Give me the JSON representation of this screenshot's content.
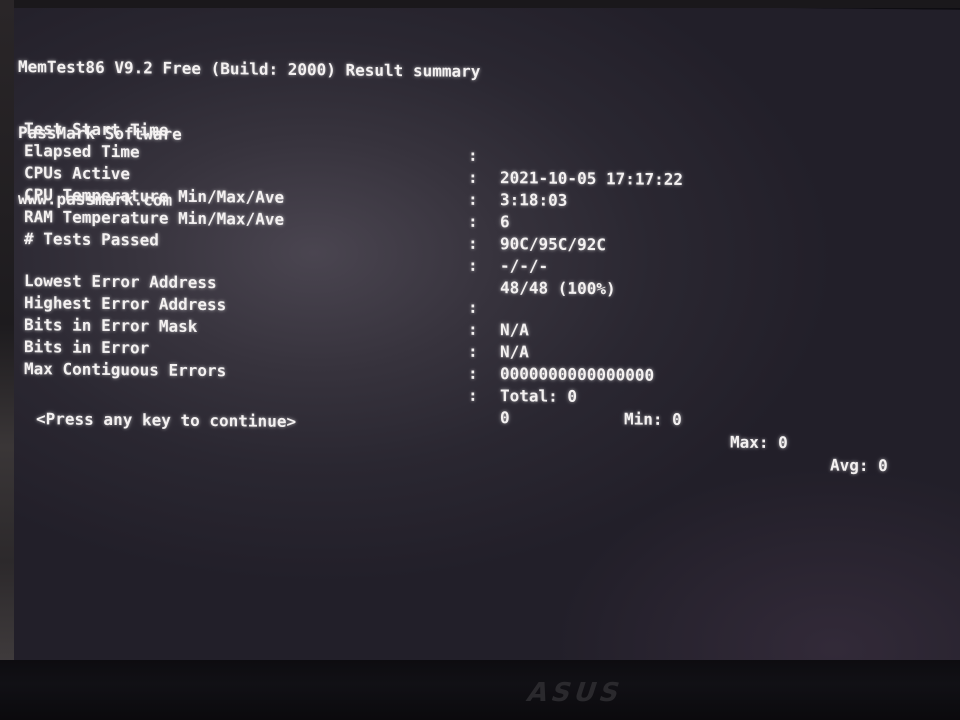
{
  "header": {
    "title": "MemTest86 V9.2 Free (Build: 2000) Result summary",
    "vendor": "PassMark Software",
    "website": "www.passmark.com"
  },
  "summary": [
    {
      "label": "Test Start Time",
      "value": "2021-10-05 17:17:22"
    },
    {
      "label": "Elapsed Time",
      "value": "3:18:03"
    },
    {
      "label": "CPUs Active",
      "value": "6"
    },
    {
      "label": "CPU Temperature Min/Max/Ave",
      "value": "90C/95C/92C"
    },
    {
      "label": "RAM Temperature Min/Max/Ave",
      "value": "-/-/-"
    },
    {
      "label": "# Tests Passed",
      "value": "48/48 (100%)"
    }
  ],
  "errors": {
    "lowest_error_address": {
      "label": "Lowest Error Address",
      "value": "N/A"
    },
    "highest_error_address": {
      "label": "Highest Error Address",
      "value": "N/A"
    },
    "bits_in_error_mask": {
      "label": "Bits in Error Mask",
      "value": "0000000000000000"
    },
    "bits_in_error": {
      "label": "Bits in Error",
      "total": "Total: 0",
      "min": "Min: 0",
      "max": "Max: 0",
      "avg": "Avg: 0"
    },
    "max_contiguous_errors": {
      "label": "Max Contiguous Errors",
      "value": "0"
    }
  },
  "separator": ":",
  "prompt": "<Press any key to continue>",
  "bezel_logo": "ASUS"
}
